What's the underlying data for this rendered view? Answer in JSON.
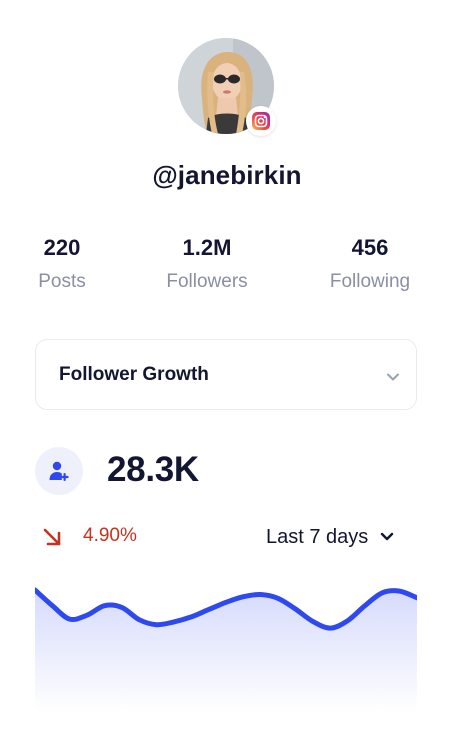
{
  "profile": {
    "username": "@janebirkin",
    "platform_icon": "instagram-icon"
  },
  "stats": [
    {
      "value": "220",
      "label": "Posts"
    },
    {
      "value": "1.2M",
      "label": "Followers"
    },
    {
      "value": "456",
      "label": "Following"
    }
  ],
  "metric_select": {
    "selected": "Follower Growth",
    "icon": "chevron-down-icon"
  },
  "metric": {
    "icon": "user-add-icon",
    "value": "28.3K",
    "change": "4.90%",
    "change_direction": "down",
    "change_icon": "arrow-down-right-icon"
  },
  "period": {
    "selected": "Last 7 days",
    "icon": "chevron-down-icon"
  },
  "sparkline": {
    "values": [
      100,
      72,
      48,
      55,
      72,
      69,
      47,
      38,
      43,
      52,
      65,
      78,
      88,
      92,
      85,
      66,
      44,
      32,
      45,
      72,
      95,
      98,
      86
    ],
    "min": 0,
    "max": 100
  },
  "colors": {
    "accent": "#2f49f0",
    "text_primary": "#121631",
    "text_secondary": "#8a8fa3",
    "negative": "#c7321f",
    "border": "#e9ebf0",
    "icon_bg": "#eef0fb"
  }
}
